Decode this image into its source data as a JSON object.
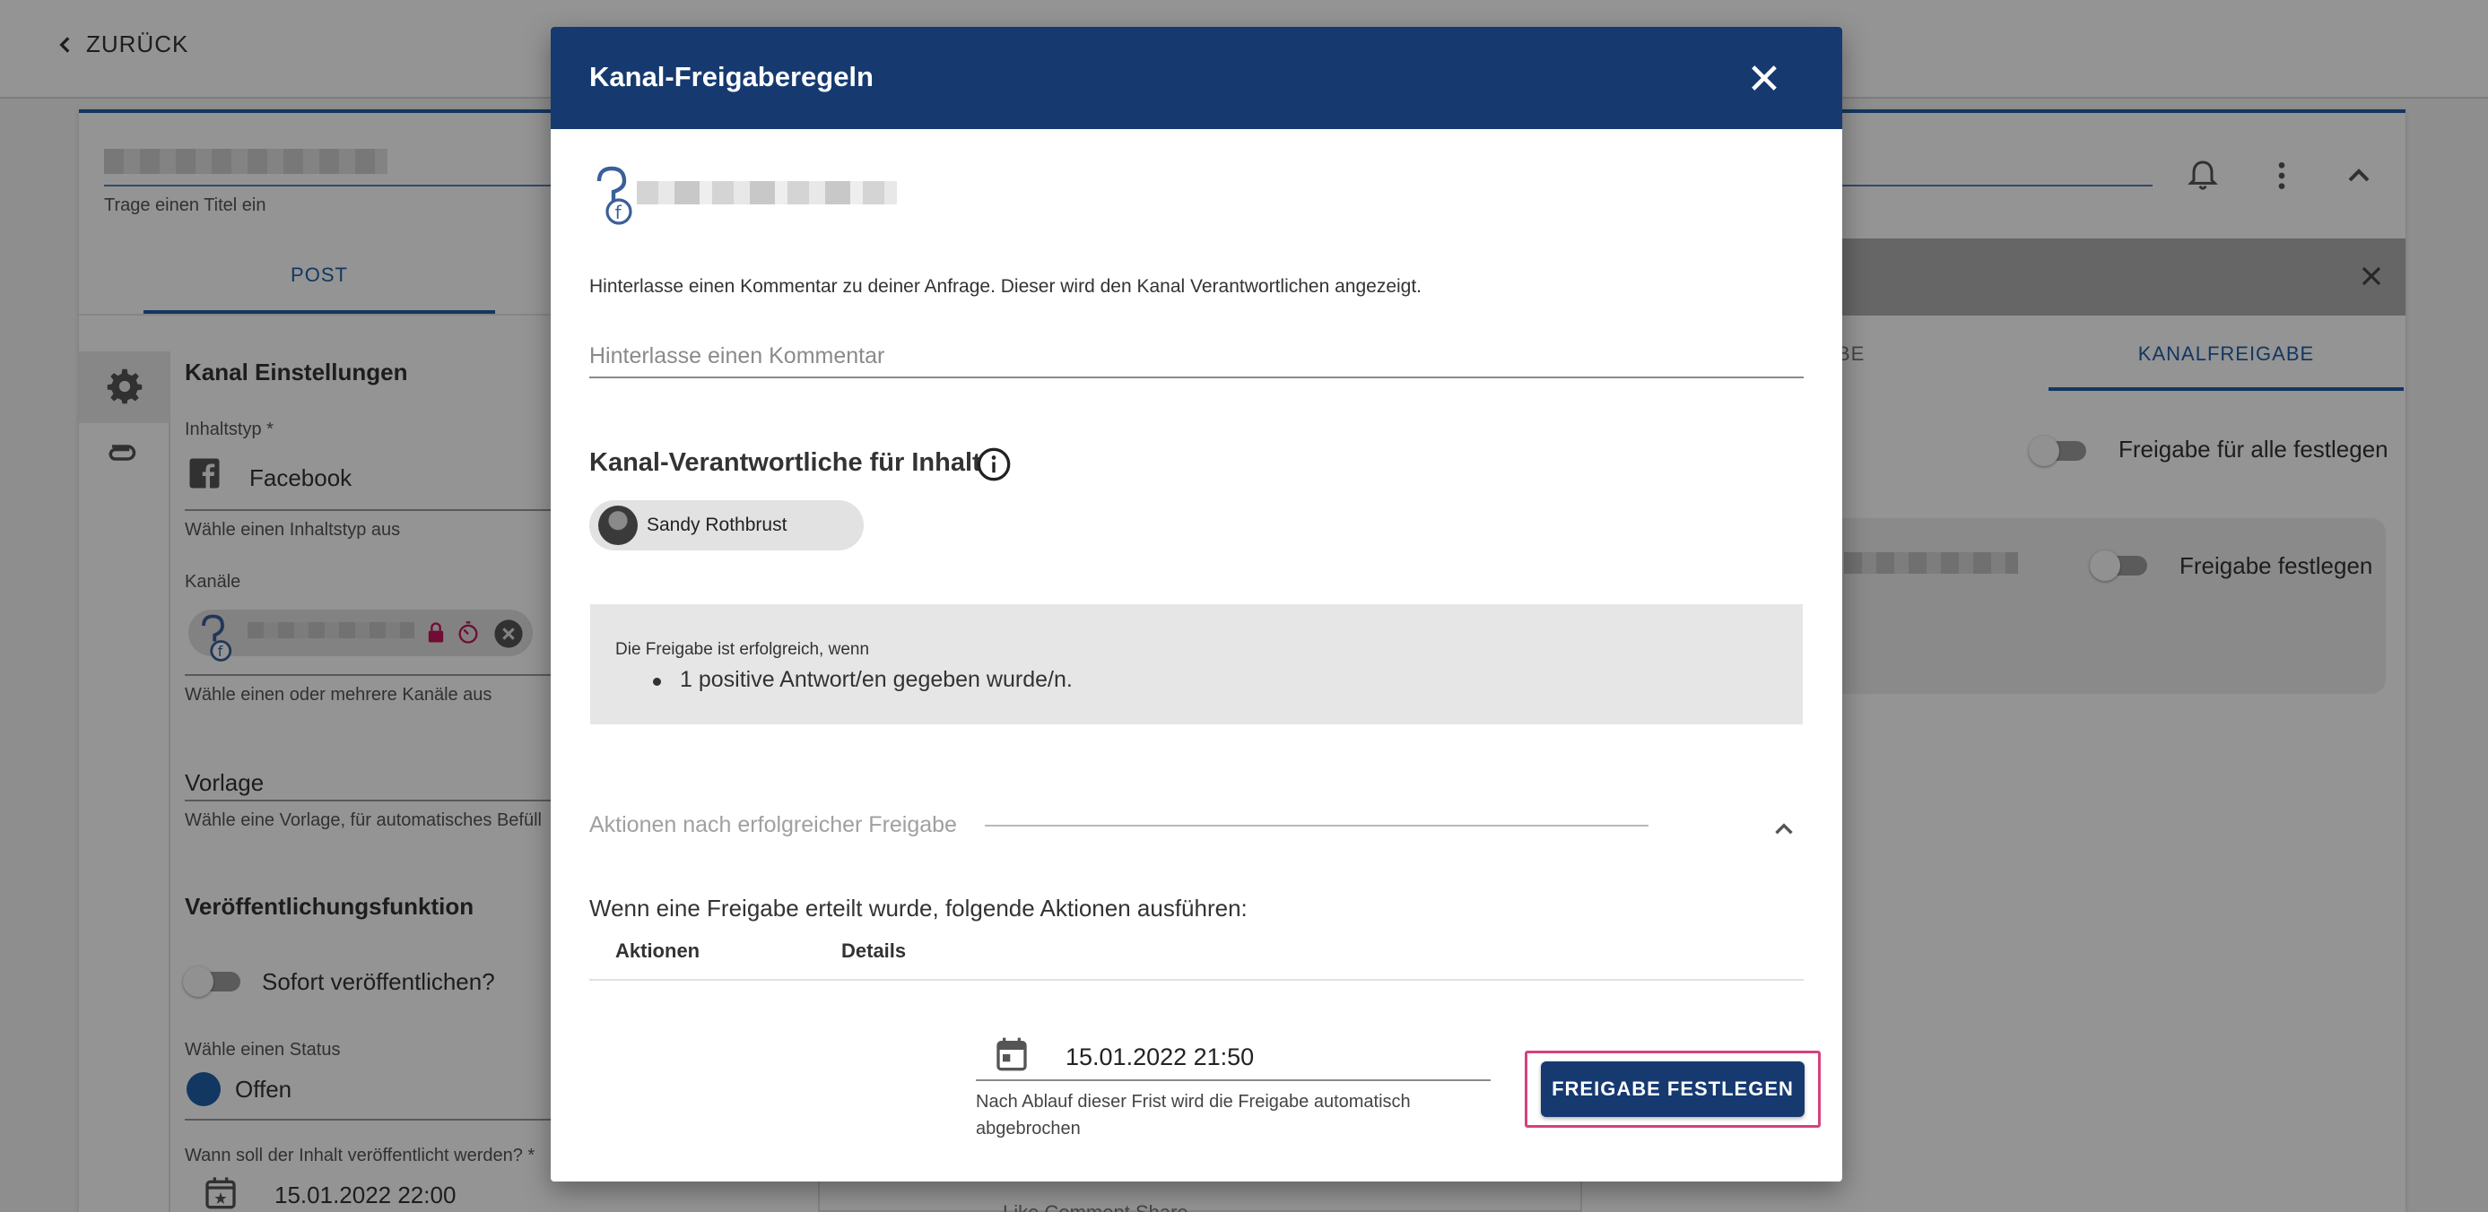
{
  "background": {
    "back_label": "ZURÜCK",
    "title_hint": "Trage einen Titel ein",
    "tab_post": "POST",
    "section_channel_settings": "Kanal Einstellungen",
    "content_type_label": "Inhaltstyp *",
    "content_type_value": "Facebook",
    "content_type_hint": "Wähle einen Inhaltstyp aus",
    "channels_label": "Kanäle",
    "channels_hint": "Wähle einen oder mehrere Kanäle aus",
    "template_label": "Vorlage",
    "template_hint": "Wähle eine Vorlage, für automatisches Befüll",
    "publish_section": "Veröffentlichungsfunktion",
    "publish_now_label": "Sofort veröffentlichen?",
    "status_label": "Wähle einen Status",
    "status_value": "Offen",
    "when_label": "Wann soll der Inhalt veröffentlicht werden? *",
    "when_value": "15.01.2022 22:00",
    "preview_actions": "Like     Comment     Share",
    "right_tab_1": "TSFREIGABE",
    "right_tab_2": "KANALFREIGABE",
    "approve_all_label": "Freigabe für alle festlegen",
    "approve_label": "Freigabe festlegen"
  },
  "dialog": {
    "title": "Kanal-Freigaberegeln",
    "comment_hint": "Hinterlasse einen Kommentar zu deiner Anfrage. Dieser wird den Kanal Verantwortlichen angezeigt.",
    "comment_placeholder": "Hinterlasse einen Kommentar",
    "responsible_title": "Kanal-Verantwortliche für Inhalt",
    "responsible_person": "Sandy Rothbrust",
    "condition_label": "Die Freigabe ist erfolgreich, wenn",
    "condition_item": "1 positive Antwort/en gegeben wurde/n.",
    "actions_title": "Aktionen nach erfolgreicher Freigabe",
    "actions_intro": "Wenn eine Freigabe erteilt wurde, folgende Aktionen ausführen:",
    "col_actions": "Aktionen",
    "col_details": "Details",
    "deadline_value": "15.01.2022 21:50",
    "deadline_hint": "Nach Ablauf dieser Frist wird die Freigabe automatisch abgebrochen",
    "submit_label": "FREIGABE FESTLEGEN"
  },
  "colors": {
    "primary": "#163a70",
    "accent": "#1f5fa8",
    "highlight": "#d6417d"
  }
}
